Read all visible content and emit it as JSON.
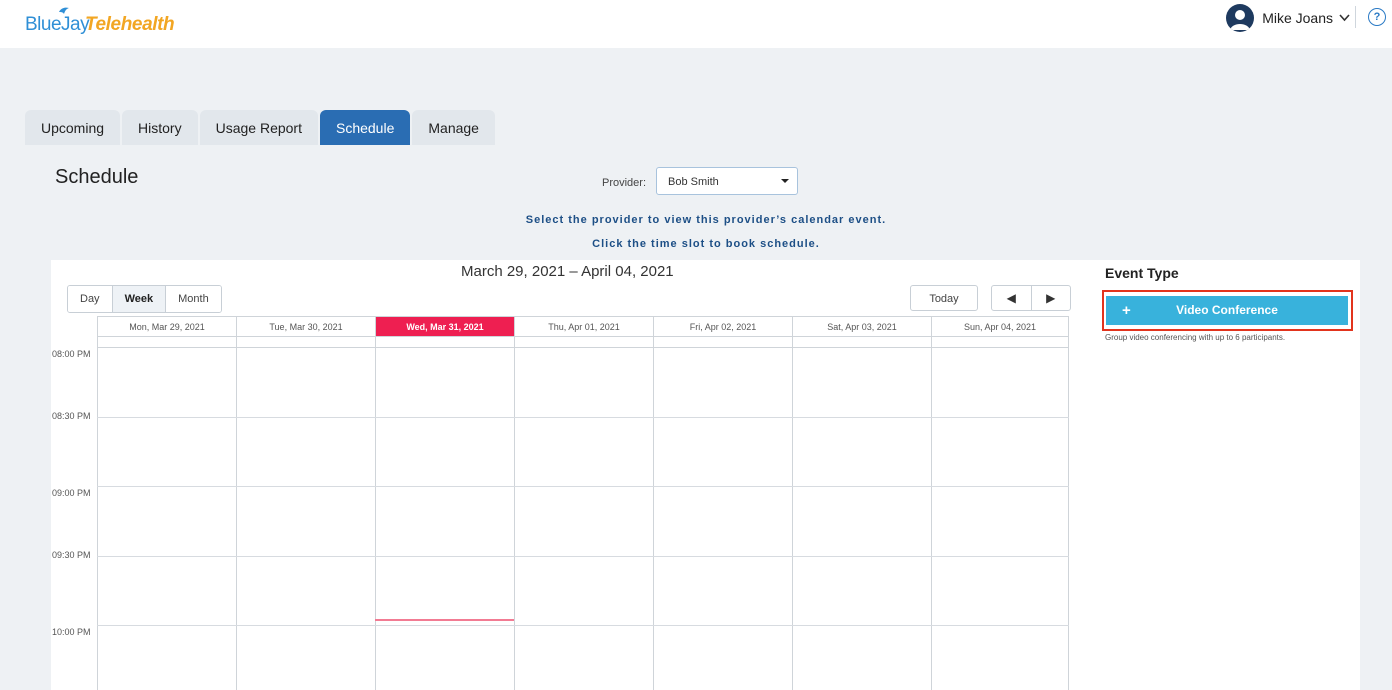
{
  "brand": {
    "part1": "BlueJay",
    "part2": "Telehealth"
  },
  "user": {
    "name": "Mike Joans",
    "help_label": "?"
  },
  "tabs": [
    {
      "label": "Upcoming"
    },
    {
      "label": "History"
    },
    {
      "label": "Usage Report"
    },
    {
      "label": "Schedule",
      "active": true
    },
    {
      "label": "Manage"
    }
  ],
  "page": {
    "title": "Schedule",
    "provider_label": "Provider:",
    "provider_value": "Bob Smith",
    "hint_1": "Select the provider to view this provider’s calendar event.",
    "hint_2": "Click the time slot to book schedule."
  },
  "calendar": {
    "range_title": "March 29, 2021 – April 04, 2021",
    "views": [
      {
        "label": "Day"
      },
      {
        "label": "Week",
        "active": true
      },
      {
        "label": "Month"
      }
    ],
    "today_label": "Today",
    "prev_label": "◀",
    "next_label": "▶",
    "days": [
      "Mon, Mar 29, 2021",
      "Tue, Mar 30, 2021",
      "Wed, Mar 31, 2021",
      "Thu, Apr 01, 2021",
      "Fri, Apr 02, 2021",
      "Sat, Apr 03, 2021",
      "Sun, Apr 04, 2021"
    ],
    "today_day": "Wed, Mar 31, 2021",
    "times": [
      "08:00 PM",
      "08:30 PM",
      "09:00 PM",
      "09:30 PM",
      "10:00 PM"
    ]
  },
  "event_panel": {
    "title": "Event Type",
    "button_label": "Video Conference",
    "button_icon": "plus-icon",
    "description": "Group video conferencing with up to 6 participants."
  },
  "colors": {
    "brand_blue": "#2f8fd6",
    "brand_orange": "#f2a623",
    "tab_active": "#2a6db3",
    "today_header": "#ee1f51",
    "vc_button": "#38b2dc",
    "highlight_outline": "#e2341d"
  }
}
